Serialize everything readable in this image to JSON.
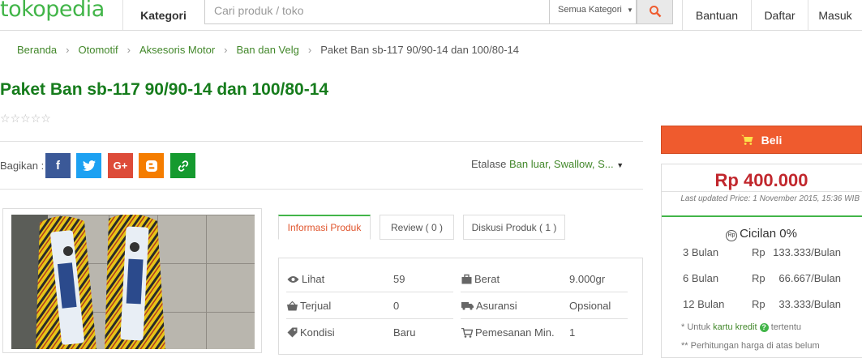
{
  "header": {
    "logo": "tokopedia",
    "kategori": "Kategori",
    "search_placeholder": "Cari produk / toko",
    "search_category": "Semua Kategori",
    "bantuan": "Bantuan",
    "daftar": "Daftar",
    "masuk": "Masuk"
  },
  "breadcrumb": {
    "items": [
      "Beranda",
      "Otomotif",
      "Aksesoris Motor",
      "Ban dan Velg"
    ],
    "current": "Paket Ban sb-117 90/90-14 dan 100/80-14"
  },
  "product": {
    "title": "Paket Ban sb-117 90/90-14 dan 100/80-14",
    "rating_stars": 0,
    "share_label": "Bagikan :",
    "etalase_label": "Etalase",
    "etalase_value": "Ban luar, Swallow, S..."
  },
  "tabs": [
    {
      "label": "Informasi Produk",
      "active": true
    },
    {
      "label": "Review ( 0 )",
      "active": false
    },
    {
      "label": "Diskusi Produk ( 1 )",
      "active": false
    }
  ],
  "info": {
    "lihat_label": "Lihat",
    "lihat_value": "59",
    "terjual_label": "Terjual",
    "terjual_value": "0",
    "kondisi_label": "Kondisi",
    "kondisi_value": "Baru",
    "berat_label": "Berat",
    "berat_value": "9.000gr",
    "asuransi_label": "Asuransi",
    "asuransi_value": "Opsional",
    "pemesanan_label": "Pemesanan Min.",
    "pemesanan_value": "1"
  },
  "purchase": {
    "buy_label": "Beli",
    "price": "Rp 400.000",
    "updated": "Last updated Price: 1 November 2015, 15:36 WIB",
    "cicilan_title": "Cicilan 0%",
    "installments": [
      {
        "months": "3 Bulan",
        "currency": "Rp",
        "amount": "133.333/Bulan"
      },
      {
        "months": "6 Bulan",
        "currency": "Rp",
        "amount": "66.667/Bulan"
      },
      {
        "months": "12 Bulan",
        "currency": "Rp",
        "amount": "33.333/Bulan"
      }
    ],
    "note1_prefix": "* Untuk",
    "note1_link": "kartu kredit",
    "note1_suffix": "tertentu",
    "note2": "** Perhitungan harga di atas belum"
  },
  "colors": {
    "brand_green": "#42b549",
    "title_green": "#167c1c",
    "buy_orange": "#ef5b2e",
    "price_red": "#c1272d"
  }
}
